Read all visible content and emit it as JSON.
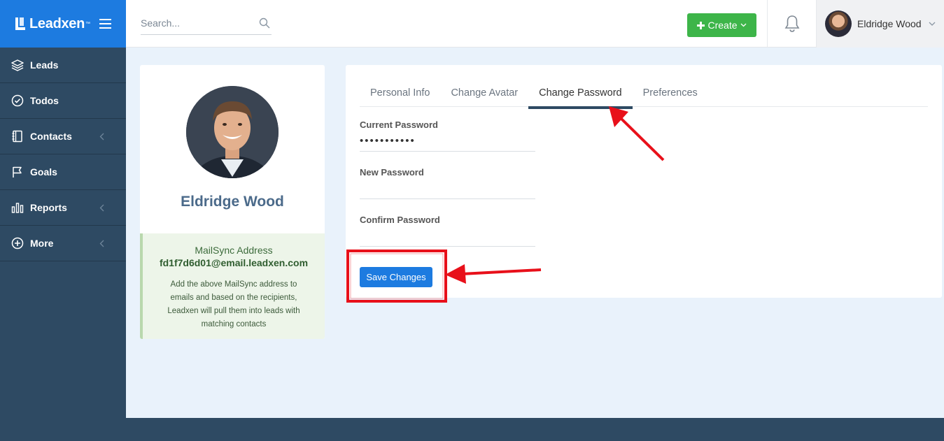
{
  "brand": {
    "name": "Leadxen",
    "tm": "™"
  },
  "search": {
    "placeholder": "Search..."
  },
  "header": {
    "create_label": "Create",
    "user_name": "Eldridge Wood"
  },
  "sidebar": {
    "items": [
      {
        "label": "Leads",
        "icon": "layers-icon",
        "has_chevron": false
      },
      {
        "label": "Todos",
        "icon": "check-circle-icon",
        "has_chevron": false
      },
      {
        "label": "Contacts",
        "icon": "contact-book-icon",
        "has_chevron": true
      },
      {
        "label": "Goals",
        "icon": "flag-icon",
        "has_chevron": false
      },
      {
        "label": "Reports",
        "icon": "bar-chart-icon",
        "has_chevron": true
      },
      {
        "label": "More",
        "icon": "plus-circle-icon",
        "has_chevron": true
      }
    ]
  },
  "profile": {
    "name": "Eldridge Wood",
    "mailsync_title": "MailSync Address",
    "mailsync_email": "fd1f7d6d01@email.leadxen.com",
    "mailsync_desc": "Add the above MailSync address to emails and based on the recipients, Leadxen will pull them into leads with matching contacts"
  },
  "tabs": [
    {
      "label": "Personal Info",
      "active": false
    },
    {
      "label": "Change Avatar",
      "active": false
    },
    {
      "label": "Change Password",
      "active": true
    },
    {
      "label": "Preferences",
      "active": false
    }
  ],
  "form": {
    "current_label": "Current Password",
    "current_value": "•••••••••••",
    "new_label": "New Password",
    "new_value": "",
    "confirm_label": "Confirm Password",
    "confirm_value": "",
    "save_label": "Save Changes"
  },
  "colors": {
    "brand_blue": "#1d7be0",
    "sidebar": "#2e4a63",
    "create_green": "#3db549",
    "annotation_red": "#e8101a"
  }
}
